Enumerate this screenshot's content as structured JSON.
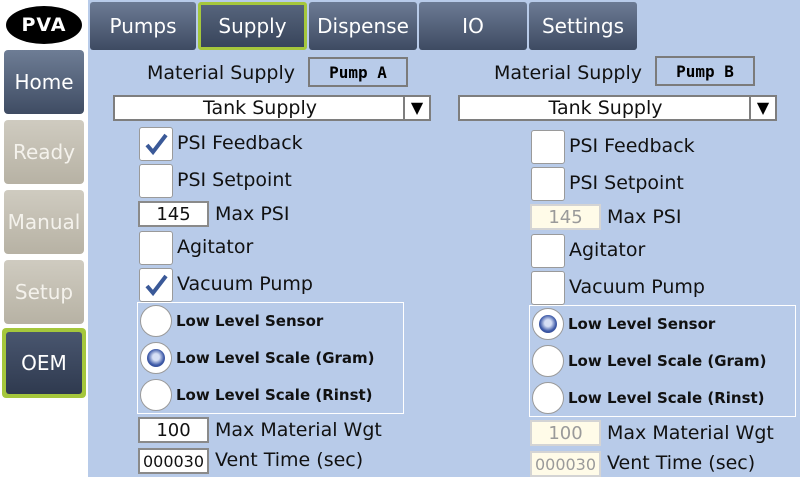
{
  "logo": {
    "text": "PVA"
  },
  "nav": [
    {
      "label": "Home"
    },
    {
      "label": "Ready"
    },
    {
      "label": "Manual"
    },
    {
      "label": "Setup"
    },
    {
      "label": "OEM"
    }
  ],
  "tabs": [
    {
      "label": "Pumps"
    },
    {
      "label": "Supply"
    },
    {
      "label": "Dispense"
    },
    {
      "label": "IO"
    },
    {
      "label": "Settings"
    }
  ],
  "pumpA": {
    "material_supply_label": "Material Supply",
    "pump_name": "Pump A",
    "supply_type": "Tank Supply",
    "psi_feedback": {
      "label": "PSI Feedback",
      "checked": true
    },
    "psi_setpoint": {
      "label": "PSI Setpoint",
      "checked": false
    },
    "max_psi": {
      "value": "145",
      "label": "Max PSI"
    },
    "agitator": {
      "label": "Agitator",
      "checked": false
    },
    "vacuum_pump": {
      "label": "Vacuum Pump",
      "checked": true
    },
    "low_level": {
      "options": [
        "Low Level Sensor",
        "Low Level Scale (Gram)",
        "Low Level Scale (Rinst)"
      ],
      "selected": "Low Level Scale (Gram)"
    },
    "max_material_wgt": {
      "value": "100",
      "label": "Max Material Wgt"
    },
    "vent_time": {
      "value": "000030",
      "label": "Vent Time (sec)"
    }
  },
  "pumpB": {
    "material_supply_label": "Material Supply",
    "pump_name": "Pump B",
    "supply_type": "Tank Supply",
    "psi_feedback": {
      "label": "PSI Feedback",
      "checked": false
    },
    "psi_setpoint": {
      "label": "PSI Setpoint",
      "checked": false
    },
    "max_psi": {
      "value": "145",
      "label": "Max PSI"
    },
    "agitator": {
      "label": "Agitator",
      "checked": false
    },
    "vacuum_pump": {
      "label": "Vacuum Pump",
      "checked": false
    },
    "low_level": {
      "options": [
        "Low Level Sensor",
        "Low Level Scale (Gram)",
        "Low Level Scale (Rinst)"
      ],
      "selected": "Low Level Sensor"
    },
    "max_material_wgt": {
      "value": "100",
      "label": "Max Material Wgt"
    },
    "vent_time": {
      "value": "000030",
      "label": "Vent Time (sec)"
    }
  },
  "colors": {
    "panel_bg": "#b8cbe9",
    "accent": "#a5c73c",
    "button_dark": "#3f4c63",
    "button_disabled": "#b7b2a4"
  },
  "icons": {
    "check": "checkmark-icon",
    "dropdown": "triangle-down-icon",
    "radio": "radio-dot-icon"
  }
}
